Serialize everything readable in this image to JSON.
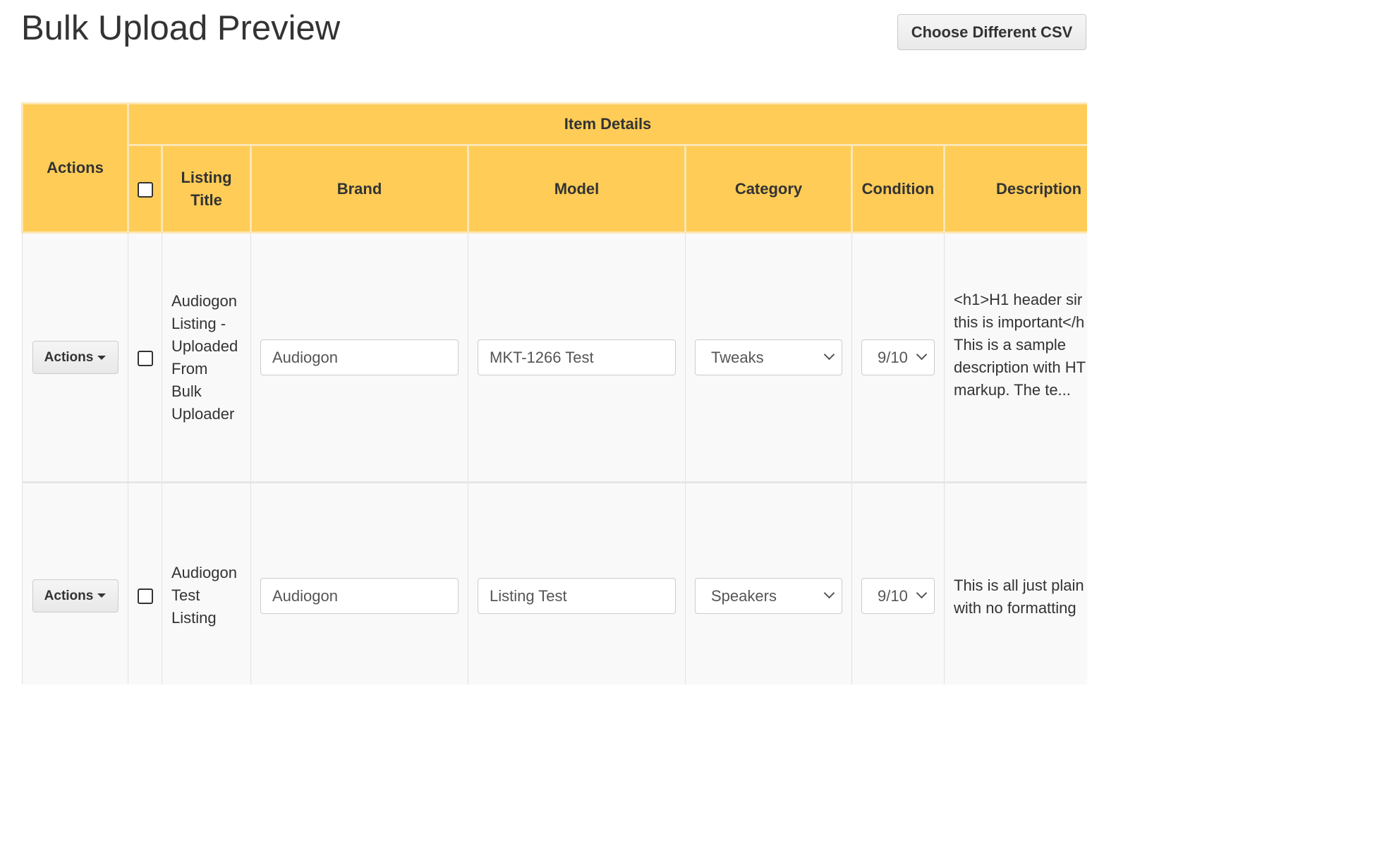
{
  "page": {
    "title": "Bulk Upload Preview",
    "choose_csv_label": "Choose Different CSV"
  },
  "table": {
    "headers": {
      "actions": "Actions",
      "item_details": "Item Details",
      "listing_title": "Listing Title",
      "brand": "Brand",
      "model": "Model",
      "category": "Category",
      "condition": "Condition",
      "description": "Description"
    },
    "rows": [
      {
        "actions_label": "Actions",
        "selected": false,
        "listing_title": "Audiogon Listing - Uploaded From Bulk Uploader",
        "brand": "Audiogon",
        "model": "MKT-1266 Test",
        "category": "Tweaks",
        "condition": "9/10",
        "description_lines": [
          "<h1>H1 header sir",
          "this is important</h",
          "This is a sample",
          "description with HT",
          "markup. The te..."
        ]
      },
      {
        "actions_label": "Actions",
        "selected": false,
        "listing_title": "Audiogon Test Listing",
        "brand": "Audiogon",
        "model": "Listing Test",
        "category": "Speakers",
        "condition": "9/10",
        "description_lines": [
          "This is all just plain",
          "with no formatting"
        ]
      }
    ]
  },
  "colors": {
    "header_bg": "#fecc57",
    "header_border": "#fbe7b6",
    "row_bg": "#f9f9f9"
  }
}
